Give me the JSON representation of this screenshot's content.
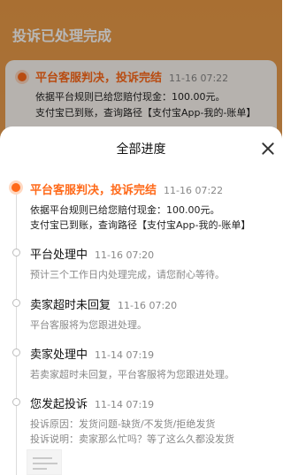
{
  "background": {
    "title": "投诉已处理完成",
    "card": {
      "title": "平台客服判决，投诉完结",
      "time": "11-16 07:22",
      "lines": [
        "依据平台规则已给您赔付现金：100.00元。",
        "支付宝已到账，查询路径【支付宝App-我的-账单】"
      ]
    }
  },
  "sheet": {
    "title": "全部进度",
    "steps": [
      {
        "title": "平台客服判决，投诉完结",
        "time": "11-16 07:22",
        "lines": [
          "依据平台规则已给您赔付现金：100.00元。",
          "支付宝已到账，查询路径【支付宝App-我的-账单】"
        ],
        "active": true
      },
      {
        "title": "平台处理中",
        "time": "11-16 07:20",
        "lines": [
          "预计三个工作日内处理完成，请您耐心等待。"
        ],
        "active": false
      },
      {
        "title": "卖家超时未回复",
        "time": "11-16 07:20",
        "lines": [
          "平台客服将为您跟进处理。"
        ],
        "active": false
      },
      {
        "title": "卖家处理中",
        "time": "11-14 07:19",
        "lines": [
          "若卖家超时未回复，平台客服将为您跟进处理。"
        ],
        "active": false
      },
      {
        "title": "您发起投诉",
        "time": "11-14 07:19",
        "lines": [
          "投诉原因：发货问题-缺货/不发货/拒绝发货",
          "投诉说明：卖家那么忙吗？等了这么久都没发货"
        ],
        "active": false
      }
    ]
  },
  "colors": {
    "accent": "#ff6a1a",
    "header_bg": "#ea9a46"
  },
  "icons": {
    "close": "close-icon"
  }
}
